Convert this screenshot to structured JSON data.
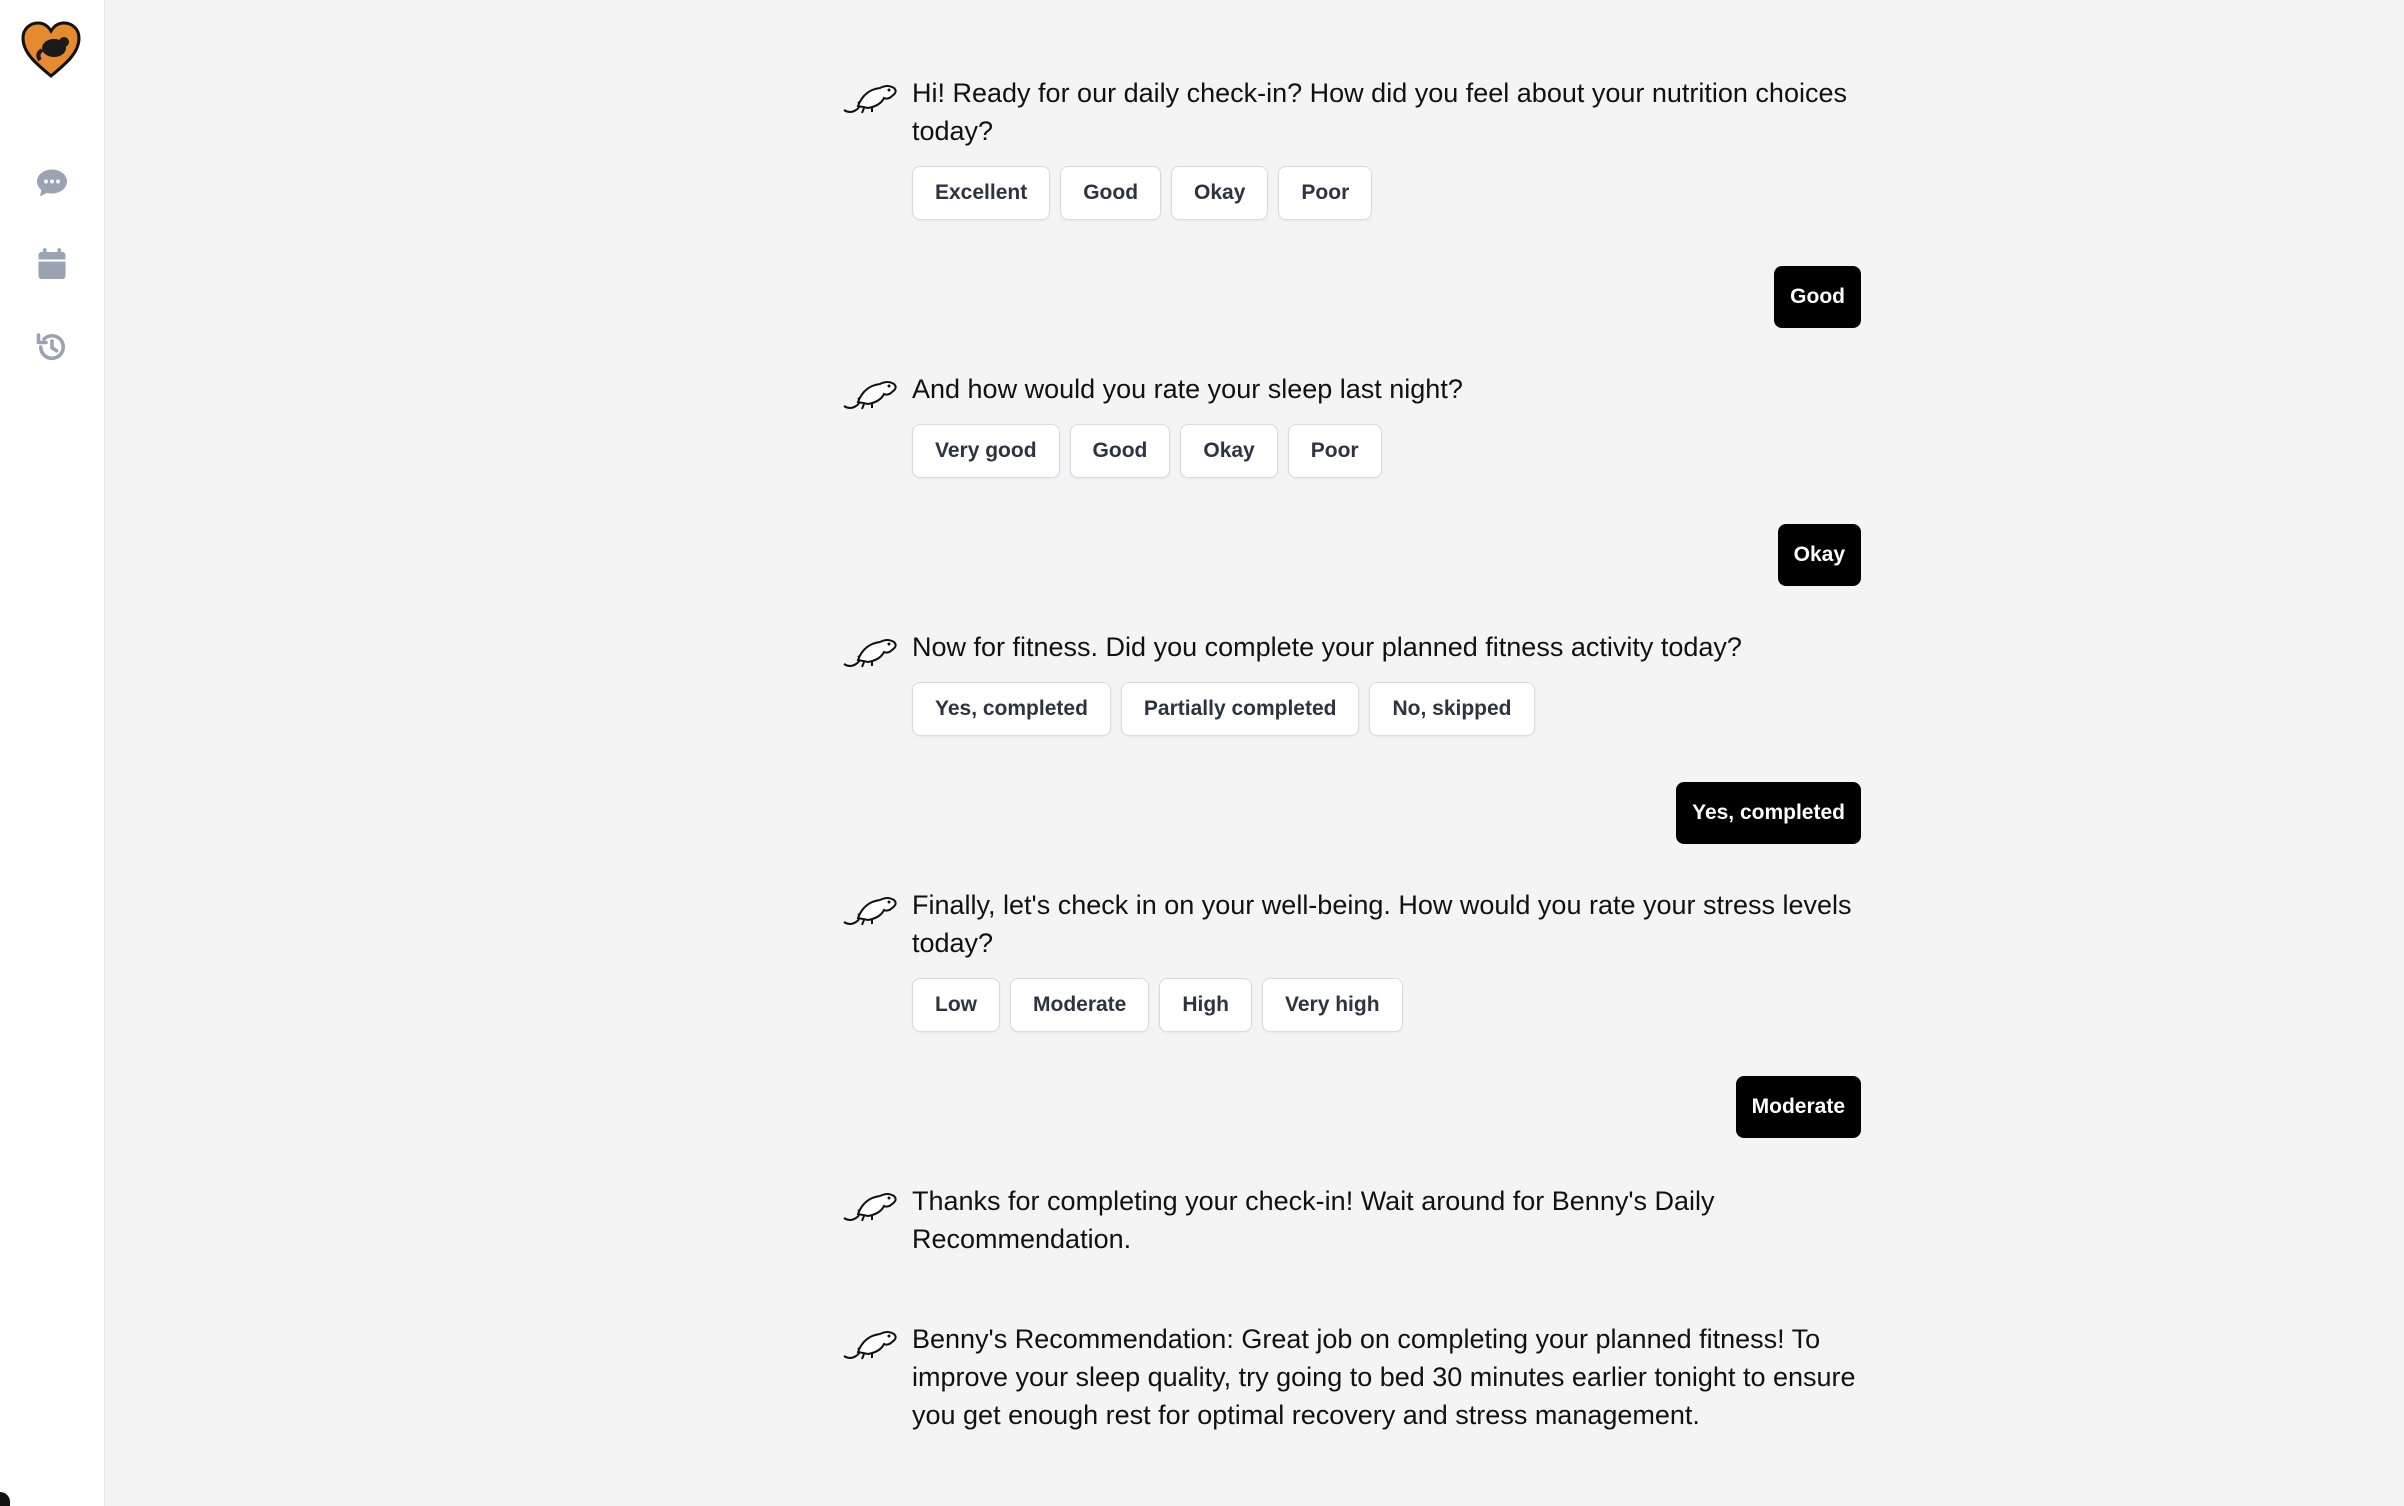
{
  "sidebar": {
    "logo": "benny-heart-logo",
    "items": [
      {
        "name": "chat",
        "icon": "chat-bubble-icon"
      },
      {
        "name": "calendar",
        "icon": "calendar-icon"
      },
      {
        "name": "history",
        "icon": "history-icon"
      }
    ]
  },
  "colors": {
    "accent": "#e58a2e",
    "reply_bg": "#000000",
    "background": "#f5f4f5"
  },
  "conversation": {
    "m1": {
      "text": "Hi! Ready for our daily check-in? How did you feel about your nutrition choices today?",
      "options": [
        "Excellent",
        "Good",
        "Okay",
        "Poor"
      ],
      "reply": "Good"
    },
    "m2": {
      "text": "And how would you rate your sleep last night?",
      "options": [
        "Very good",
        "Good",
        "Okay",
        "Poor"
      ],
      "reply": "Okay"
    },
    "m3": {
      "text": "Now for fitness. Did you complete your planned fitness activity today?",
      "options": [
        "Yes, completed",
        "Partially completed",
        "No, skipped"
      ],
      "reply": "Yes, completed"
    },
    "m4": {
      "text": "Finally, let's check in on your well-being. How would you rate your stress levels today?",
      "options": [
        "Low",
        "Moderate",
        "High",
        "Very high"
      ],
      "reply": "Moderate"
    },
    "m5": {
      "text": "Thanks for completing your check-in! Wait around for Benny's Daily Recommendation."
    },
    "m6": {
      "text": "Benny's Recommendation: Great job on completing your planned fitness! To improve your sleep quality, try going to bed 30 minutes earlier tonight to ensure you get enough rest for optimal recovery and stress management."
    }
  }
}
